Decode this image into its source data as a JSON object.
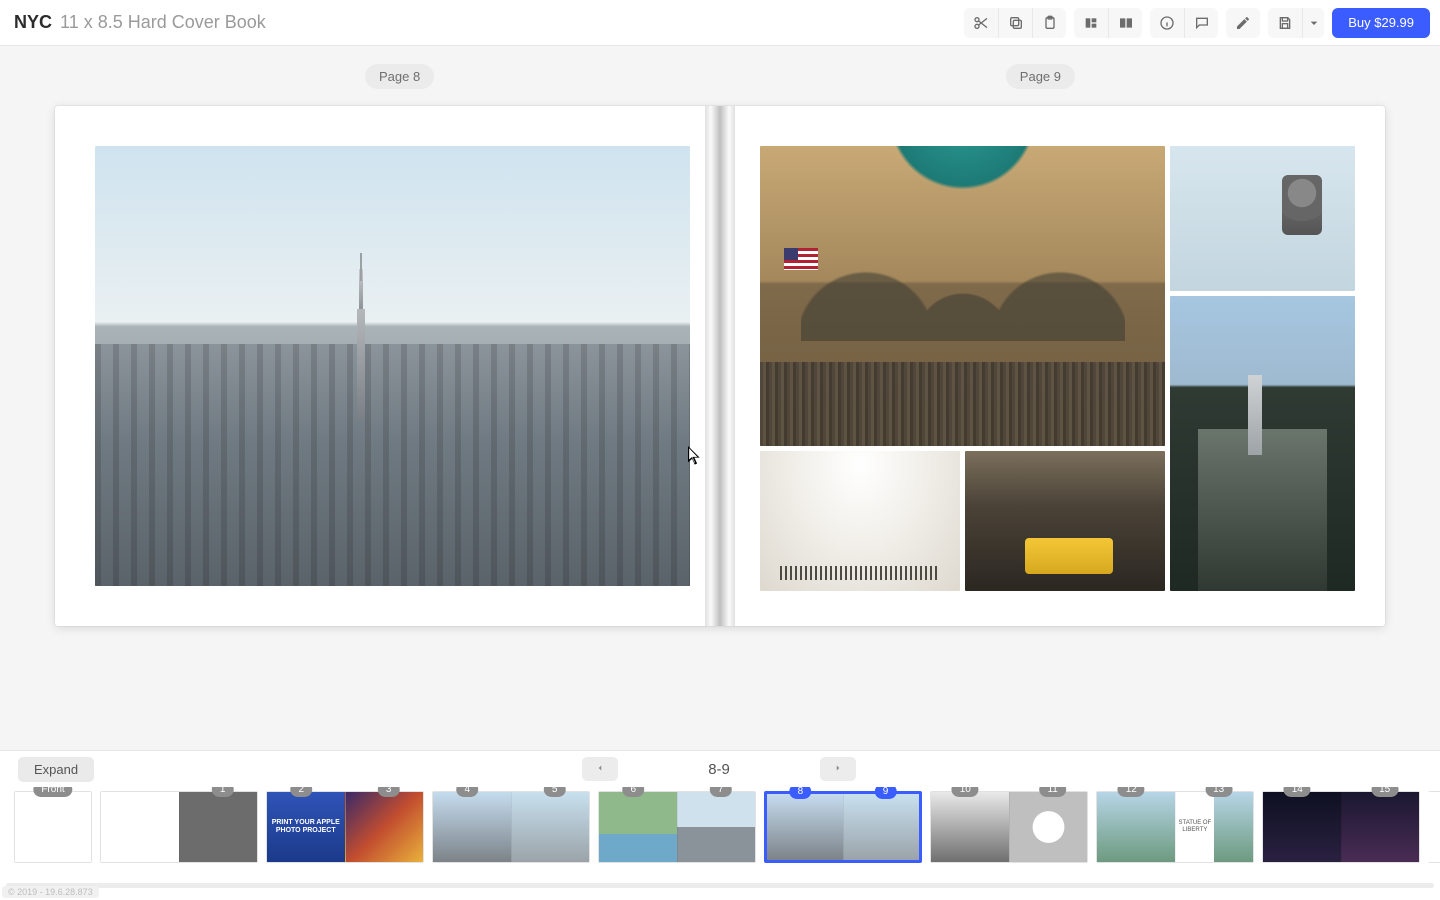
{
  "header": {
    "title": "NYC",
    "subtitle": "11 x 8.5 Hard Cover Book",
    "buy_label": "Buy $29.99"
  },
  "toolbar_icons": {
    "cut": "cut",
    "copy": "copy",
    "paste": "paste",
    "layout": "layout",
    "spread": "spread",
    "info": "info",
    "comment": "comment",
    "edit": "edit",
    "save": "save",
    "more": "more"
  },
  "spread": {
    "left_label": "Page 8",
    "right_label": "Page 9"
  },
  "footer": {
    "expand_label": "Expand",
    "current_range": "8-9"
  },
  "thumbs": [
    {
      "badges": [
        "Front"
      ],
      "single": true
    },
    {
      "badges": [
        "1"
      ]
    },
    {
      "badges": [
        "2",
        "3"
      ]
    },
    {
      "badges": [
        "4",
        "5"
      ]
    },
    {
      "badges": [
        "6",
        "7"
      ]
    },
    {
      "badges": [
        "8",
        "9"
      ],
      "selected": true
    },
    {
      "badges": [
        "10",
        "11"
      ]
    },
    {
      "badges": [
        "12",
        "13"
      ]
    },
    {
      "badges": [
        "14",
        "15"
      ]
    }
  ],
  "thumb_text": {
    "print_project": "PRINT YOUR\nAPPLE PHOTO\nPROJECT",
    "liberty": "STATUE\nOF\nLIBERTY"
  },
  "copyright": "© 2019 - 19.6.28.873"
}
